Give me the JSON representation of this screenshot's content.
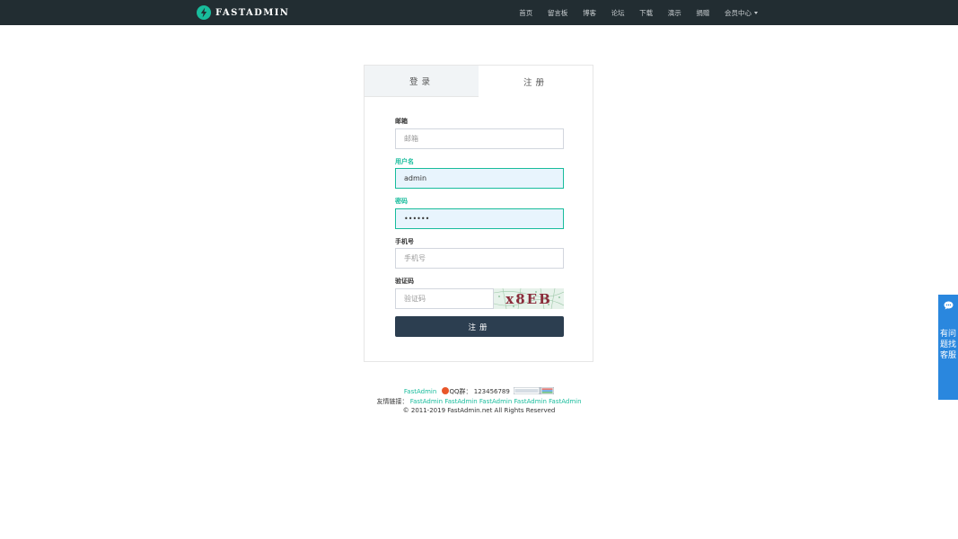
{
  "navbar": {
    "brand": "FASTADMIN",
    "items": [
      "首页",
      "留言板",
      "博客",
      "论坛",
      "下载",
      "演示",
      "捐赠",
      "会员中心"
    ]
  },
  "auth": {
    "tab_login": "登录",
    "tab_register": "注册",
    "email": {
      "label": "邮箱",
      "placeholder": "邮箱",
      "value": ""
    },
    "username": {
      "label": "用户名",
      "placeholder": "用户名",
      "value": "admin"
    },
    "password": {
      "label": "密码",
      "value": "••••••"
    },
    "mobile": {
      "label": "手机号",
      "placeholder": "手机号",
      "value": ""
    },
    "captcha": {
      "label": "验证码",
      "placeholder": "验证码",
      "image_text": "x8EB"
    },
    "submit": "注册"
  },
  "footer": {
    "brand_link": "FastAdmin",
    "qq_group": "QQ群：  123456789",
    "friend_links_label": "友情链接：",
    "friend_links": [
      "FastAdmin",
      "FastAdmin",
      "FastAdmin",
      "FastAdmin",
      "FastAdmin"
    ],
    "copyright": "© 2011-2019 FastAdmin.net All Rights Reserved"
  },
  "float_service": {
    "text": "有问题找客服"
  },
  "colors": {
    "navbar_bg": "#222d32",
    "accent": "#18bc9c",
    "button": "#2c3e50",
    "float": "#2a87de"
  }
}
